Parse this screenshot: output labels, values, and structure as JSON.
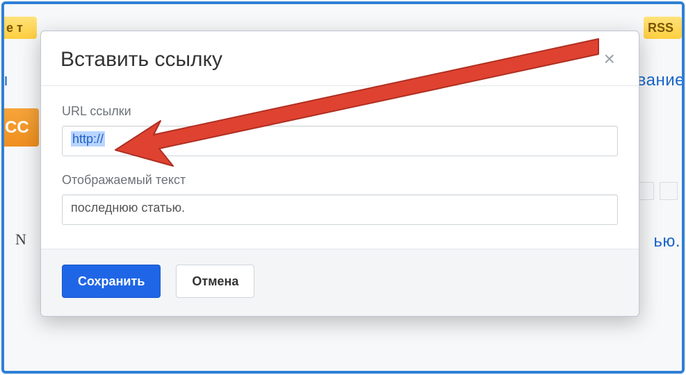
{
  "background": {
    "left_pill_text": "е т",
    "right_pill_text": "RSS",
    "orange_text": "СС",
    "link_text_left": "ы",
    "link_text_right": "ование",
    "bottom_right_text": "ью.",
    "serif_letter": "N"
  },
  "modal": {
    "title": "Вставить ссылку",
    "close_glyph": "×",
    "url_label": "URL ссылки",
    "url_value": "http://",
    "text_label": "Отображаемый текст",
    "text_value": "последнюю статью.",
    "save_label": "Сохранить",
    "cancel_label": "Отмена"
  },
  "annotation": {
    "arrow_color": "#df4230"
  }
}
